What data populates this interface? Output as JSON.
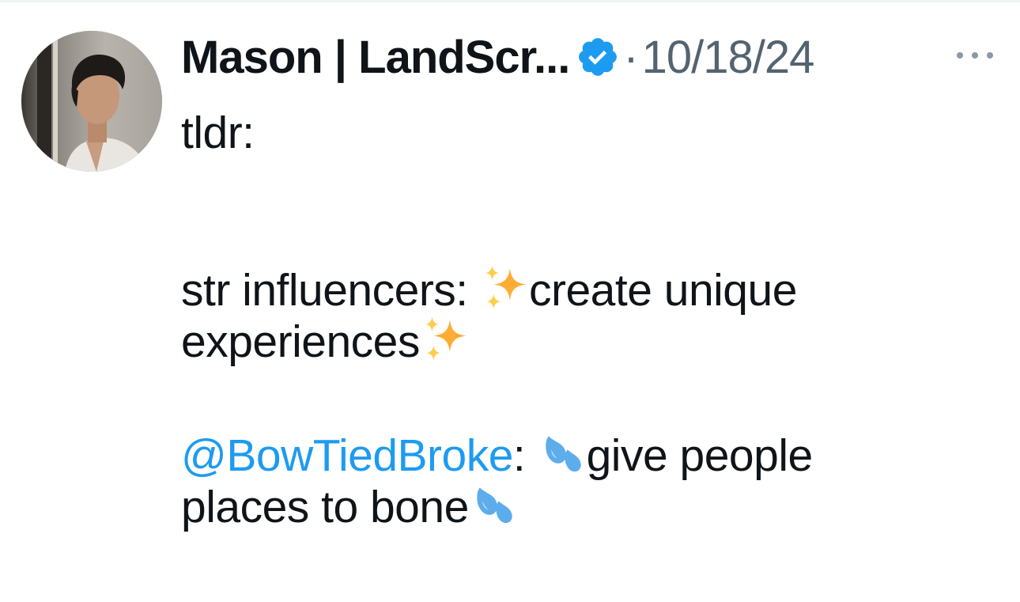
{
  "tweet": {
    "display_name": "Mason | LandScr...",
    "separator": "·",
    "timestamp": "10/18/24",
    "verified_icon": "verified-badge-icon",
    "more_icon": "more-options-icon",
    "accent_color": "#1d9bf0",
    "muted_color": "#536471",
    "body": {
      "line1": "tldr:",
      "line3_text_a": "str influencers: ",
      "line3_emoji": "sparkles",
      "line3_text_b": "create unique",
      "line4_text": "experiences",
      "line4_emoji": "sparkles",
      "mention": "@BowTiedBroke",
      "line6_colon": ": ",
      "line6_emoji": "sweat-droplets",
      "line6_text": "give people",
      "line7_text": "places to bone",
      "line7_emoji": "sweat-droplets"
    }
  }
}
